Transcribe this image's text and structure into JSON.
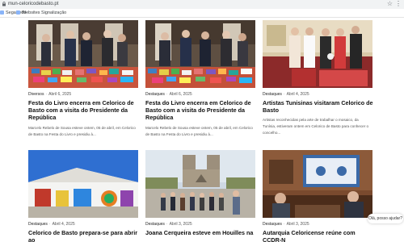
{
  "browser": {
    "url": "mun-celoricodebasto.pt",
    "bookmarks": [
      "Segafredo",
      "Websites Signalização"
    ]
  },
  "cards": [
    {
      "category": "Diversos",
      "date": "Abril 6, 2025",
      "title": "Festa do Livro encerra em Celorico de Basto com a visita do Presidente da República",
      "excerpt": "Marcelo Rebelo de Sousa esteve ontem, 05 de abril, em Celorico de Basto na Festa do Livro e presidiu à..."
    },
    {
      "category": "Destaques",
      "date": "Abril 6, 2025",
      "title": "Festa do Livro encerra em Celorico de Basto com a visita do Presidente da República",
      "excerpt": "Marcelo Rebelo de Sousa esteve ontem, 05 de abril, em Celorico de Basto na Festa do Livro e presidiu à..."
    },
    {
      "category": "Destaques",
      "date": "Abril 4, 2025",
      "title": "Artistas Tunisinas visitaram Celorico de Basto",
      "excerpt": "Artistas reconhecidas pela arte de trabalhar o mosaico, da Tunísia, estiveram ontem em Celorico de Basto para conhecer o concelho..."
    },
    {
      "category": "Destaques",
      "date": "Abril 4, 2025",
      "title": "Celorico de Basto prepara-se para abrir ao",
      "excerpt": ""
    },
    {
      "category": "Destaques",
      "date": "Abril 3, 2025",
      "title": "Joana Cerqueira esteve em Houilles na",
      "excerpt": ""
    },
    {
      "category": "Destaques",
      "date": "Abril 3, 2025",
      "title": "Autarquia Celoricense reúne com CCDR-N",
      "excerpt": ""
    }
  ],
  "help_widget": {
    "label": "Olá, posso ajudar?"
  }
}
